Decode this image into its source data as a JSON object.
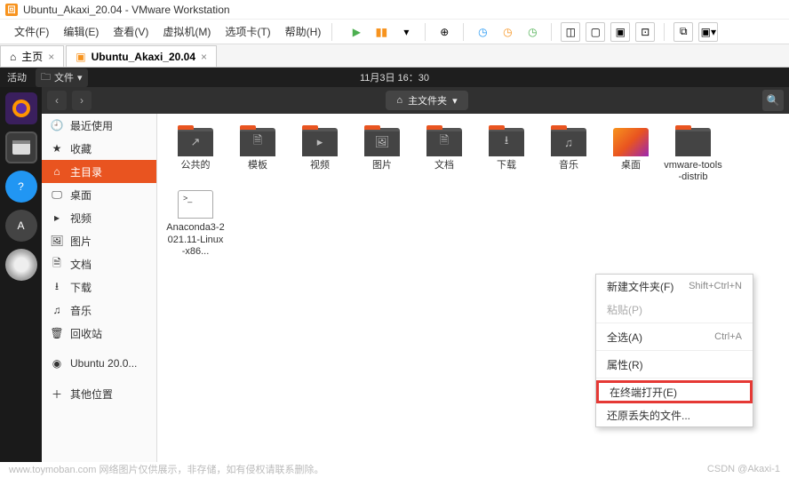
{
  "vmware": {
    "title": "Ubuntu_Akaxi_20.04 - VMware Workstation",
    "menus": [
      "文件(F)",
      "编辑(E)",
      "查看(V)",
      "虚拟机(M)",
      "选项卡(T)",
      "帮助(H)"
    ],
    "tabs": [
      {
        "icon": "home",
        "label": "主页"
      },
      {
        "icon": "vm",
        "label": "Ubuntu_Akaxi_20.04"
      }
    ]
  },
  "gnome": {
    "activities": "活动",
    "app_indicator": "文件",
    "datetime": "11月3日 16：30"
  },
  "nautilus": {
    "path_icon": "⌂",
    "path_label": "主文件夹"
  },
  "sidebar": {
    "items": [
      {
        "icon": "🕘",
        "label": "最近使用"
      },
      {
        "icon": "★",
        "label": "收藏"
      },
      {
        "icon": "⌂",
        "label": "主目录",
        "active": true
      },
      {
        "icon": "🖵",
        "label": "桌面"
      },
      {
        "icon": "▸",
        "label": "视频"
      },
      {
        "icon": "🖼",
        "label": "图片"
      },
      {
        "icon": "🗎",
        "label": "文档"
      },
      {
        "icon": "⭳",
        "label": "下载"
      },
      {
        "icon": "♫",
        "label": "音乐"
      },
      {
        "icon": "🗑",
        "label": "回收站"
      }
    ],
    "device": {
      "icon": "◉",
      "label": "Ubuntu 20.0..."
    },
    "other": {
      "icon": "＋",
      "label": "其他位置"
    }
  },
  "files": [
    {
      "type": "folder",
      "mark": "↗",
      "label": "公共的"
    },
    {
      "type": "folder",
      "mark": "🗎",
      "label": "模板"
    },
    {
      "type": "folder",
      "mark": "▸",
      "label": "视频"
    },
    {
      "type": "folder",
      "mark": "🖼",
      "label": "图片"
    },
    {
      "type": "folder",
      "mark": "🗎",
      "label": "文档"
    },
    {
      "type": "folder",
      "mark": "⭳",
      "label": "下载"
    },
    {
      "type": "folder",
      "mark": "♫",
      "label": "音乐"
    },
    {
      "type": "desktop",
      "mark": "",
      "label": "桌面"
    },
    {
      "type": "folder",
      "mark": "",
      "label": "vmware-tools-distrib"
    },
    {
      "type": "term",
      "mark": "",
      "label": "Anaconda3-2021.11-Linux-x86..."
    }
  ],
  "context_menu": {
    "items": [
      {
        "label": "新建文件夹(F)",
        "shortcut": "Shift+Ctrl+N"
      },
      {
        "label": "粘贴(P)",
        "disabled": true
      },
      {
        "label": "全选(A)",
        "shortcut": "Ctrl+A"
      },
      {
        "label": "属性(R)"
      },
      {
        "label": "在终端打开(E)",
        "highlight": true
      },
      {
        "label": "还原丢失的文件..."
      }
    ]
  },
  "footer": {
    "left": "www.toymoban.com 网络图片仅供展示，非存储，如有侵权请联系删除。",
    "right": "CSDN @Akaxi-1"
  }
}
